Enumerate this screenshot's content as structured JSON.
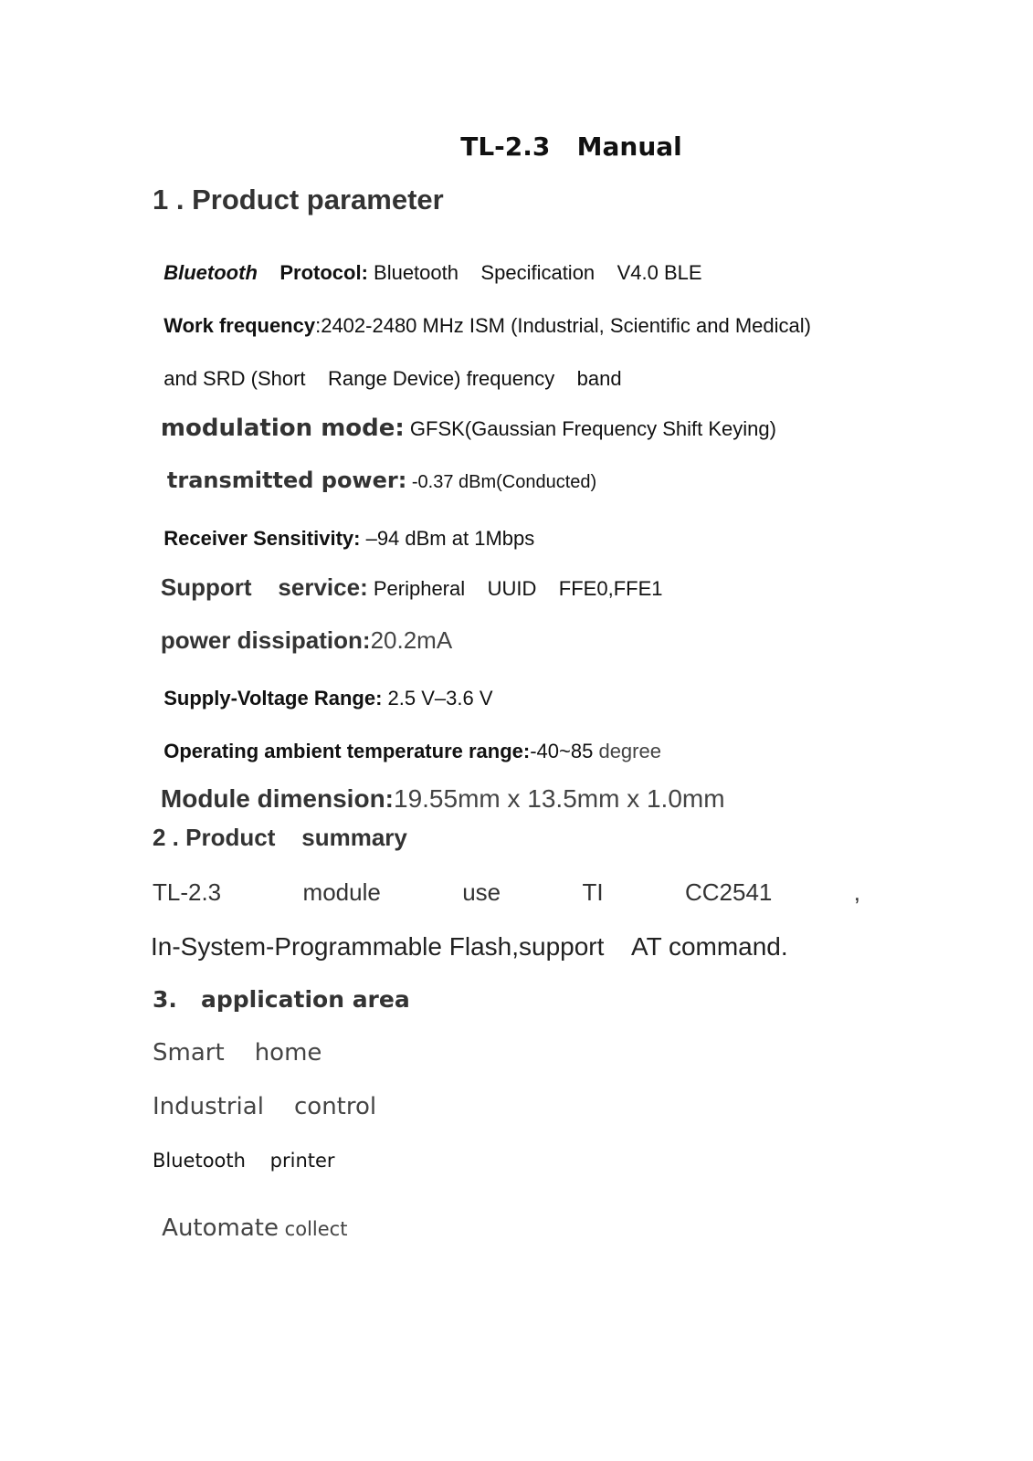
{
  "document": {
    "title": "TL-2.3   Manual",
    "section1": {
      "heading": "1 . Product parameter",
      "params": [
        {
          "label_italic": "Bluetooth",
          "label": "Protocol:",
          "value": " Bluetooth    Specification    V4.0 BLE"
        },
        {
          "label": "Work frequency",
          "value": ":2402-2480 MHz ISM (Industrial, Scientific and Medical)"
        },
        {
          "label": "",
          "value": "and SRD (Short    Range Device) frequency    band"
        },
        {
          "label": "modulation mode:",
          "value": " GFSK(Gaussian Frequency Shift Keying)"
        },
        {
          "label": "transmitted power:",
          "value": " -0.37 dBm(Conducted)"
        },
        {
          "label": "Receiver Sensitivity:",
          "value": " –94 dBm at 1Mbps"
        },
        {
          "label": "Support    service:",
          "value": " Peripheral    UUID    FFE0,FFE1"
        },
        {
          "label": "power dissipation:",
          "value": "20.2mA"
        },
        {
          "label": "Supply-Voltage Range:",
          "value": " 2.5 V–3.6 V"
        },
        {
          "label": "Operating ambient temperature range:",
          "value": "-40~85",
          "unit": " degree"
        },
        {
          "label": "Module dimension:",
          "value": "19.55mm x 13.5mm x 1.0mm"
        }
      ]
    },
    "section2": {
      "heading": "2 . Product    summary",
      "words": [
        "TL-2.3",
        "module",
        "use",
        "TI",
        "CC2541",
        ","
      ],
      "line2": "In-System-Programmable Flash,support    AT command."
    },
    "section3": {
      "heading": "3.   application area",
      "items": [
        "Smart    home",
        "Industrial    control",
        "Bluetooth    printer",
        "Automate"
      ],
      "last_suffix": " collect"
    }
  }
}
